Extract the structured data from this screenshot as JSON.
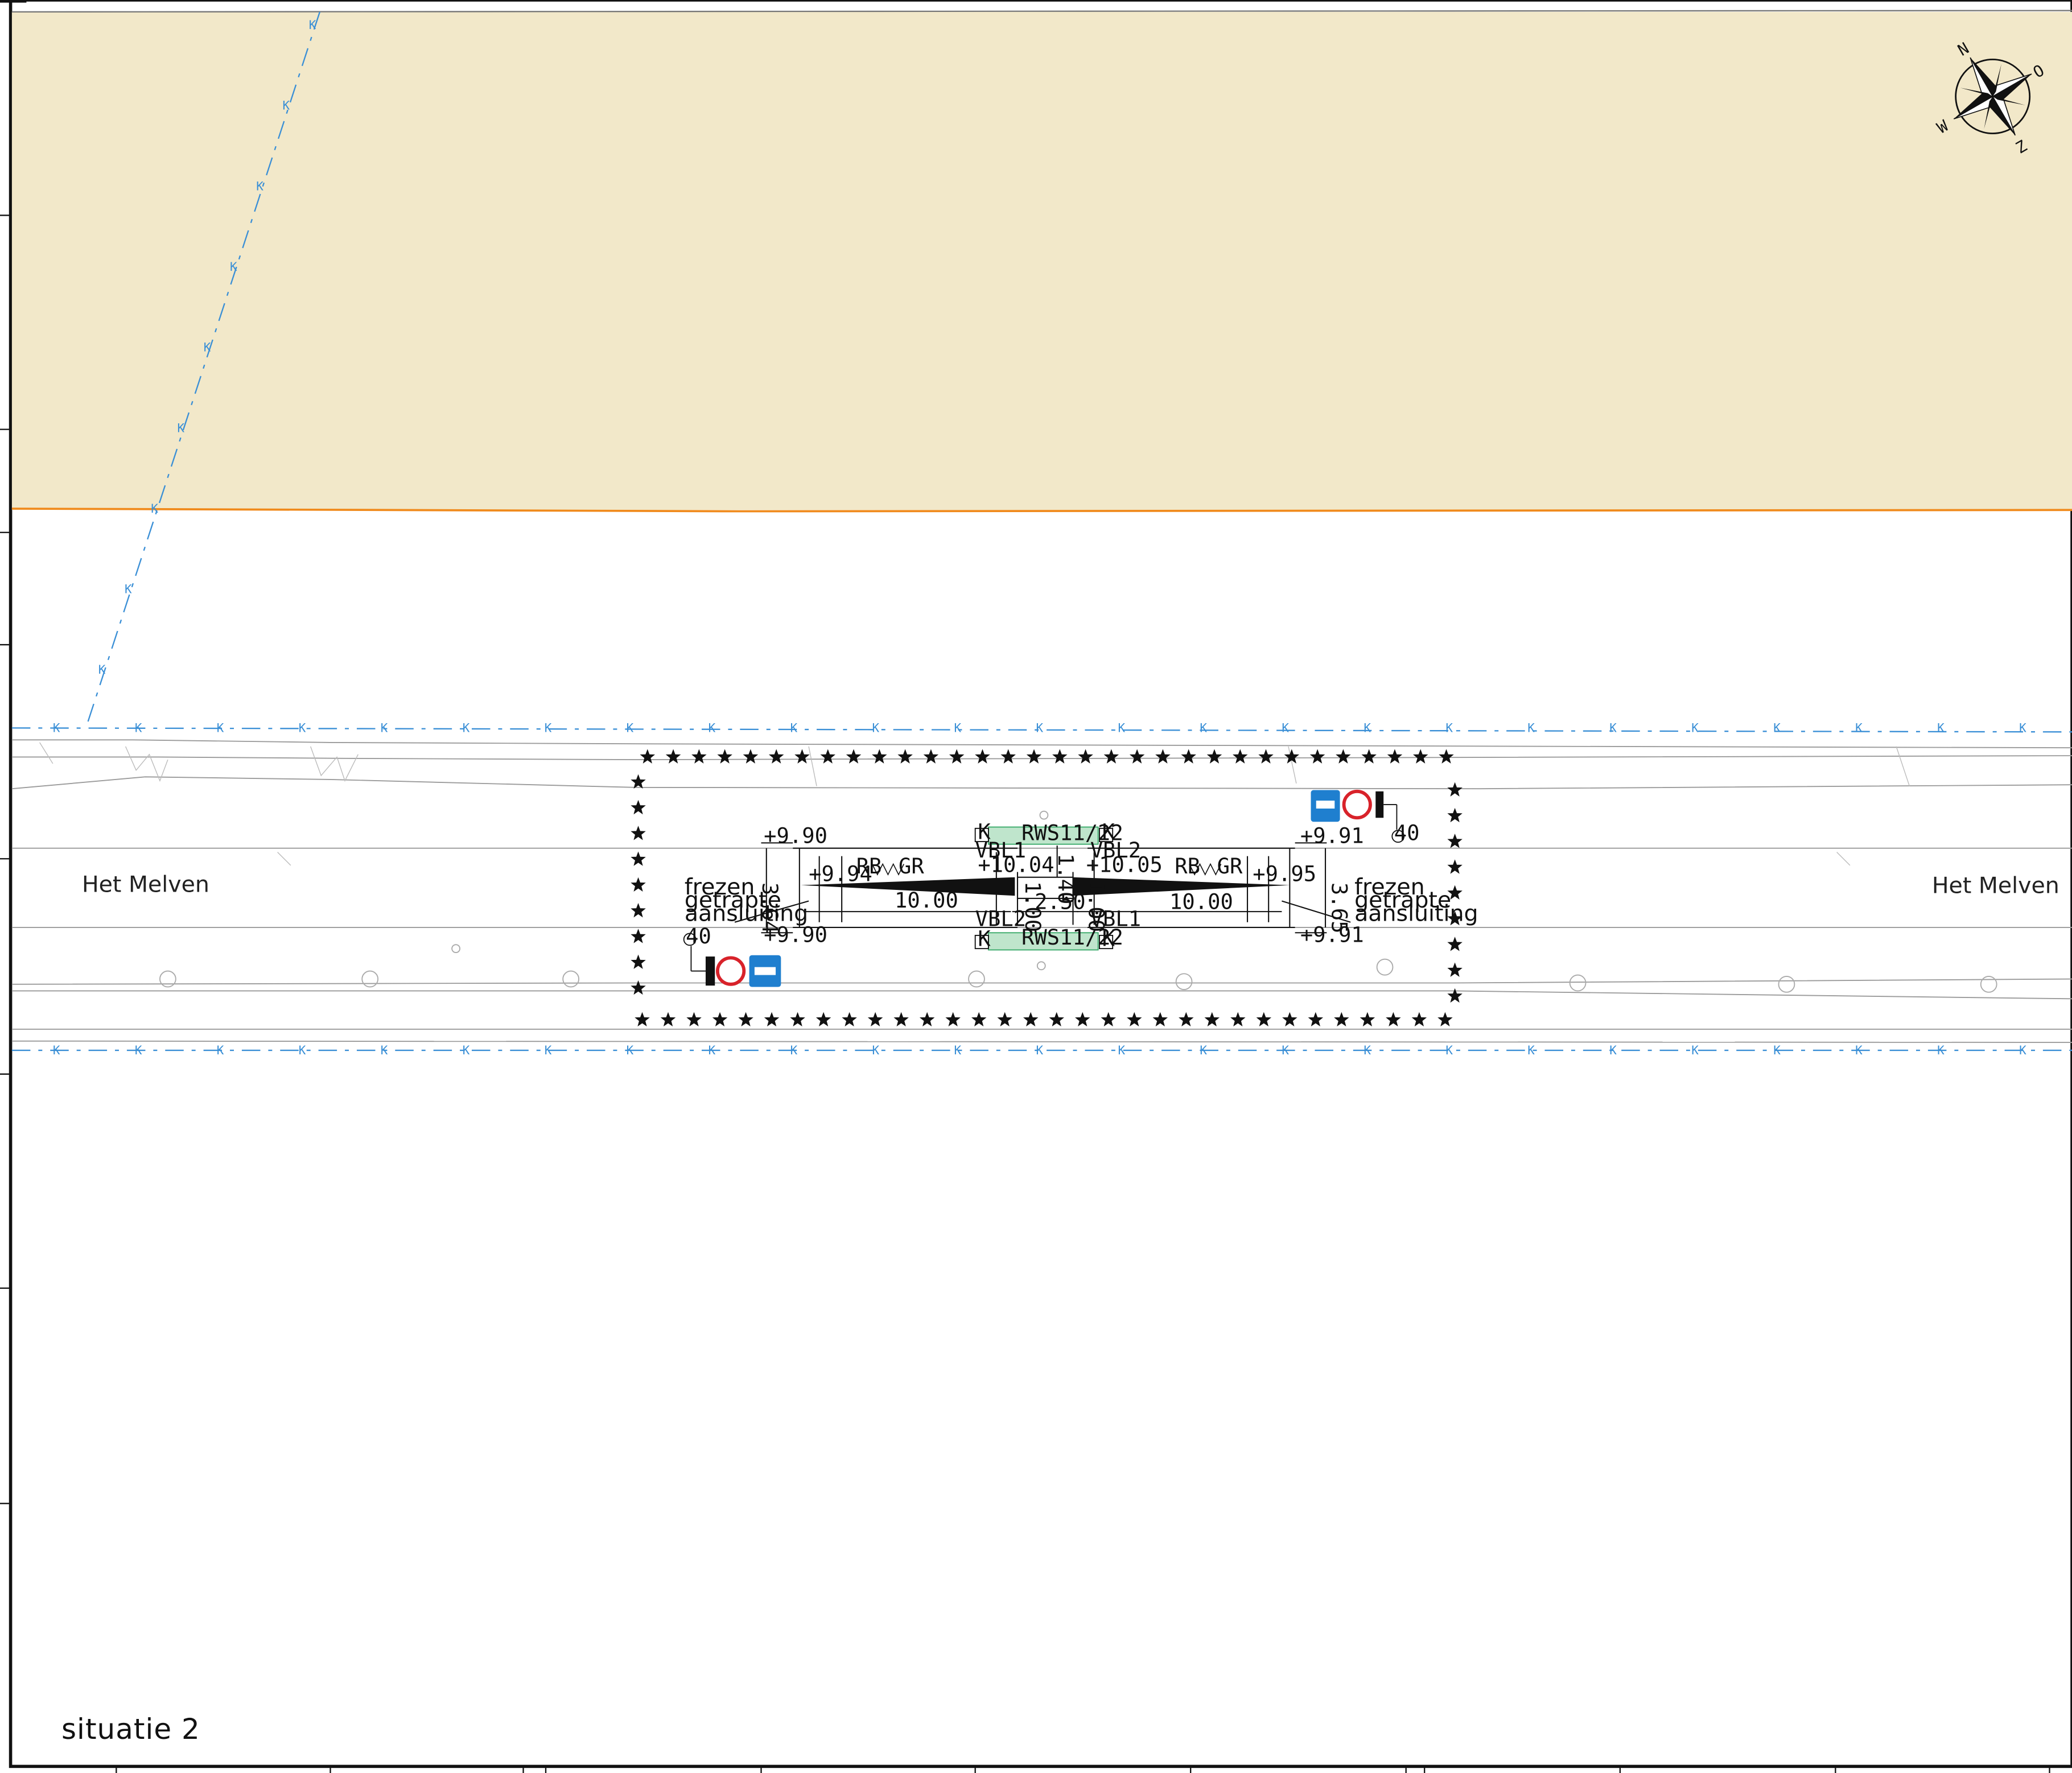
{
  "drawing": {
    "title": "situatie 2",
    "road_name_left": "Het Melven",
    "road_name_right": "Het Melven"
  },
  "compass": {
    "icon": "compass-rose-icon",
    "letters": [
      "N",
      "O",
      "Z",
      "W"
    ]
  },
  "cable_label": "K",
  "left_side": {
    "level_top": "+9.90",
    "level_bottom": "+9.90",
    "level_inner": "+9.94",
    "width": "3.64",
    "length": "10.00",
    "lane_mark_left": "RB",
    "lane_mark_right": "GR",
    "note_lines": [
      "frezen",
      "getrapte",
      "aansluiting"
    ]
  },
  "right_side": {
    "level_top": "+9.91",
    "level_bottom": "+9.91",
    "level_inner": "+9.95",
    "width": "3.65",
    "length": "10.00",
    "lane_mark_left": "RB",
    "lane_mark_right": "GR",
    "note_lines": [
      "frezen",
      "getrapte",
      "aansluiting"
    ]
  },
  "center": {
    "level_left": "+10.04",
    "level_right": "+10.05",
    "gap": "2.50",
    "height_top": "1.40",
    "height_mid_left": "1.00",
    "height_mid_right": "1.00",
    "barrier_top": "RWS11/22",
    "barrier_bottom": "RWS11/22",
    "vbl_top_left": "VBL1",
    "vbl_top_right": "VBL2",
    "vbl_bottom_left": "VBL2",
    "vbl_bottom_right": "VBL1",
    "k_marker": "K"
  },
  "signs": {
    "sign_number": "40",
    "icons": [
      "road-closed-sign-icon",
      "detour-sign-icon",
      "warning-light-icon"
    ]
  },
  "colors": {
    "field_fill": "#f2e8c9",
    "field_border": "#f08a1c",
    "cable_line": "#3a8fd6",
    "sign_blue": "#1f7fcf",
    "sign_red": "#d8222a",
    "barrier_green": "#3aaa6a"
  }
}
